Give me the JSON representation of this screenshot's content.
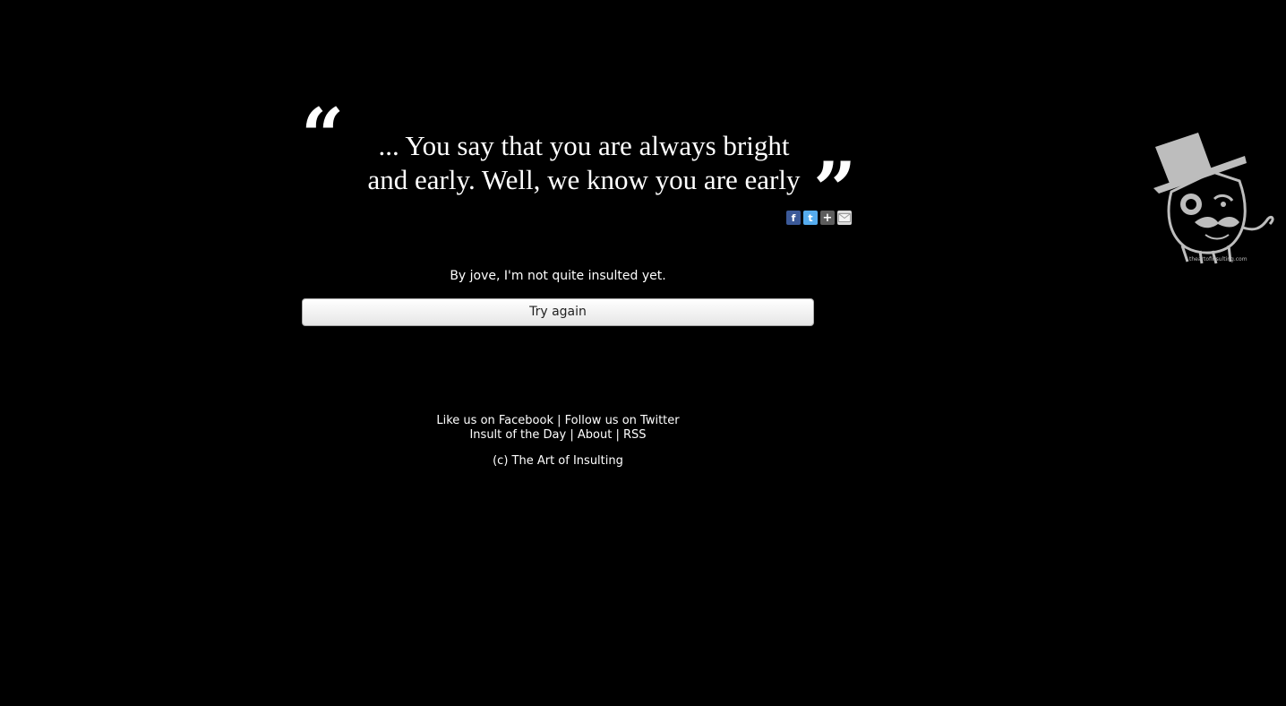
{
  "quote": {
    "open_mark": "“",
    "close_mark": "”",
    "line1": "... You say that you are always bright",
    "line2": "and early. Well, we know you are early"
  },
  "share": {
    "facebook_icon": "f",
    "twitter_icon": "t",
    "plus_icon": "+"
  },
  "result": {
    "message": "By jove, I'm not quite insulted yet.",
    "try_again_label": "Try again"
  },
  "footer": {
    "facebook_link": "Like us on Facebook",
    "twitter_link": "Follow us on Twitter",
    "insult_of_day_link": "Insult of the Day",
    "about_link": "About",
    "rss_link": "RSS",
    "separator": "|",
    "copyright": "(c) The Art of Insulting"
  },
  "mascot": {
    "caption": "theartofinsulting.com"
  },
  "colors": {
    "background": "#000000",
    "text": "#ffffff",
    "button_bg": "#f2f2f2",
    "mascot": "#bdbdbd"
  }
}
